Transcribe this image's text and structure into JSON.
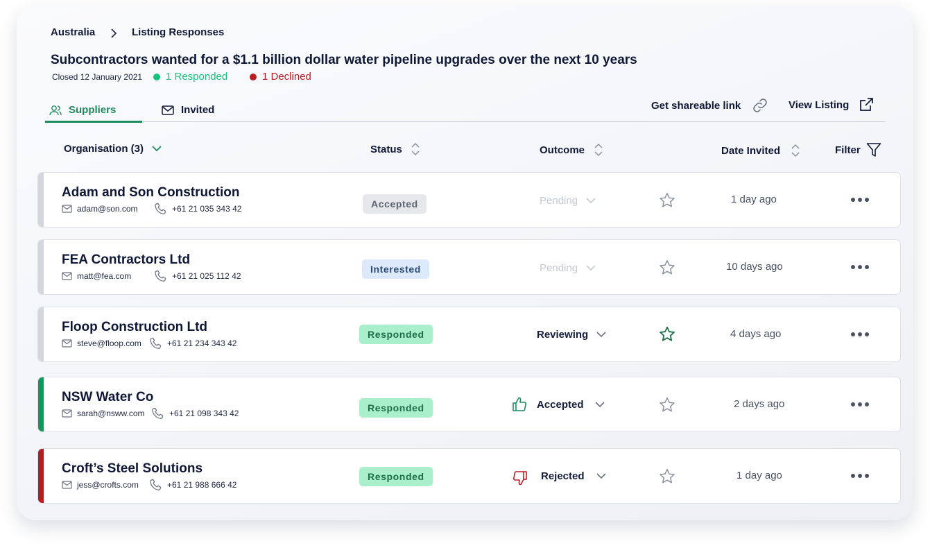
{
  "breadcrumb": {
    "root": "Australia",
    "current": "Listing Responses"
  },
  "listing": {
    "title": "Subcontractors wanted for a $1.1 billion dollar water pipeline upgrades over the next 10 years",
    "closed": "Closed 12 January 2021",
    "responded": "1 Responded",
    "declined": "1 Declined"
  },
  "tabs": {
    "suppliers": "Suppliers",
    "invited": "Invited"
  },
  "toolbar": {
    "share": "Get shareable link",
    "view": "View Listing"
  },
  "columns": {
    "organisation": "Organisation (3)",
    "status": "Status",
    "outcome": "Outcome",
    "date": "Date Invited",
    "filter": "Filter"
  },
  "rows": [
    {
      "name": "Adam and Son Construction",
      "email": "adam@son.com",
      "phone": "+61 21 035 343 42",
      "status": "Accepted",
      "outcome": "Pending",
      "starred": false,
      "date": "1 day ago"
    },
    {
      "name": "FEA Contractors Ltd",
      "email": "matt@fea.com",
      "phone": "+61 21 025 112 42",
      "status": "Interested",
      "outcome": "Pending",
      "starred": false,
      "date": "10 days ago"
    },
    {
      "name": "Floop Construction Ltd",
      "email": "steve@floop.com",
      "phone": "+61 21 234 343 42",
      "status": "Responded",
      "outcome": "Reviewing",
      "starred": true,
      "date": "4 days ago"
    },
    {
      "name": "NSW Water Co",
      "email": "sarah@nsww.com",
      "phone": "+61 21 098 343 42",
      "status": "Responded",
      "outcome": "Accepted",
      "starred": false,
      "date": "2 days ago"
    },
    {
      "name": "Croft’s Steel Solutions",
      "email": "jess@crofts.com",
      "phone": "+61 21 988 666 42",
      "status": "Responded",
      "outcome": "Rejected",
      "starred": false,
      "date": "1 day ago"
    }
  ],
  "colors": {
    "accent": "#1f8a5c",
    "responded": "#17c37a",
    "declined": "#b81c23",
    "accepted_bar": "#17955e",
    "rejected_bar": "#b81c23"
  }
}
